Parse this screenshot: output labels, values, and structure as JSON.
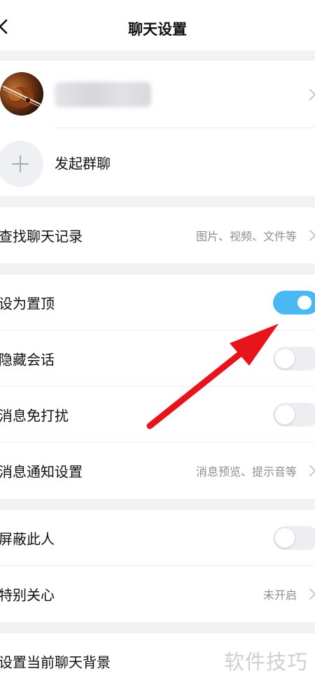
{
  "header": {
    "title": "聊天设置"
  },
  "profile": {
    "name": ""
  },
  "group": {
    "label": "发起群聊"
  },
  "search_history": {
    "label": "查找聊天记录",
    "hint": "图片、视频、文件等"
  },
  "settings": {
    "pin": {
      "label": "设为置顶",
      "on": true
    },
    "hide": {
      "label": "隐藏会话",
      "on": false
    },
    "dnd": {
      "label": "消息免打扰",
      "on": false
    },
    "notify": {
      "label": "消息通知设置",
      "hint": "消息预览、提示音等"
    }
  },
  "privacy": {
    "block": {
      "label": "屏蔽此人",
      "on": false
    },
    "special": {
      "label": "特别关心",
      "hint": "未开启"
    }
  },
  "background": {
    "label": "设置当前聊天背景"
  },
  "watermark": "软件技巧",
  "colors": {
    "toggle_on": "#4bb8f3",
    "toggle_off": "#eceef2",
    "annotation_arrow": "#e8141c"
  }
}
